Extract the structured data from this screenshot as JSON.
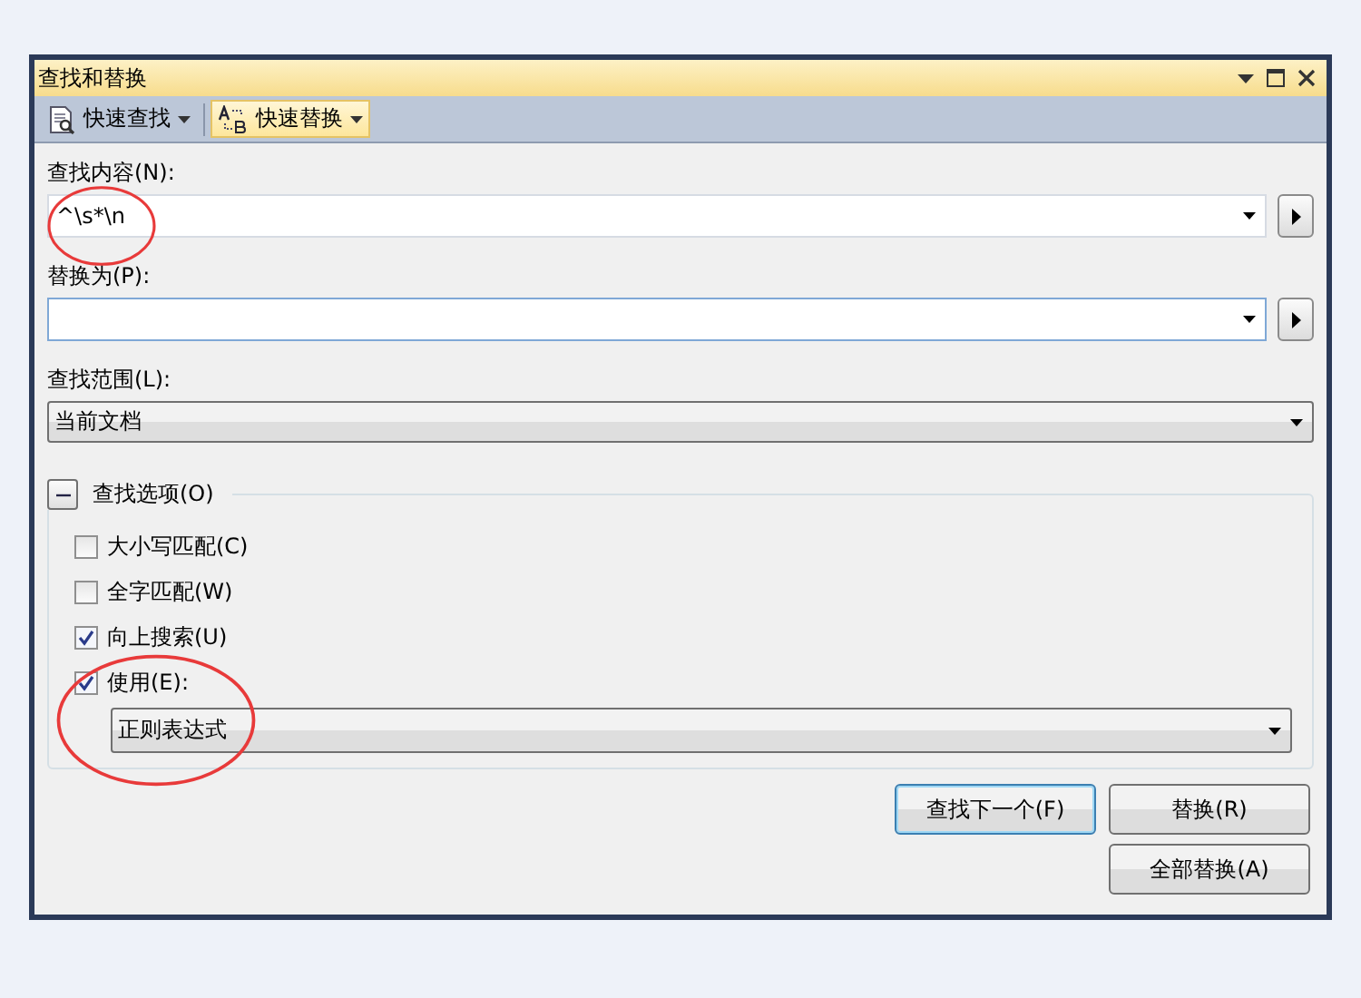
{
  "window": {
    "title": "查找和替换"
  },
  "toolbar": [
    {
      "label": "快速查找",
      "selected": false
    },
    {
      "label": "快速替换",
      "selected": true
    }
  ],
  "find": {
    "label": "查找内容(N):",
    "value": "^\\s*\\n"
  },
  "replace": {
    "label": "替换为(P):"
  },
  "scope": {
    "label": "查找范围(L):",
    "value": "当前文档"
  },
  "options": {
    "label": "查找选项(O)",
    "expanded": true,
    "checkboxes": [
      {
        "label": "大小写匹配(C)",
        "checked": false
      },
      {
        "label": "全字匹配(W)",
        "checked": false
      },
      {
        "label": "向上搜索(U)",
        "checked": true
      },
      {
        "label": "使用(E):",
        "checked": true
      }
    ],
    "mode": "正则表达式"
  },
  "buttons": [
    {
      "label": "查找下一个(F)",
      "selected": true
    },
    {
      "label": "替换(R)",
      "selected": false
    },
    {
      "label": "全部替换(A)",
      "selected": false
    }
  ]
}
